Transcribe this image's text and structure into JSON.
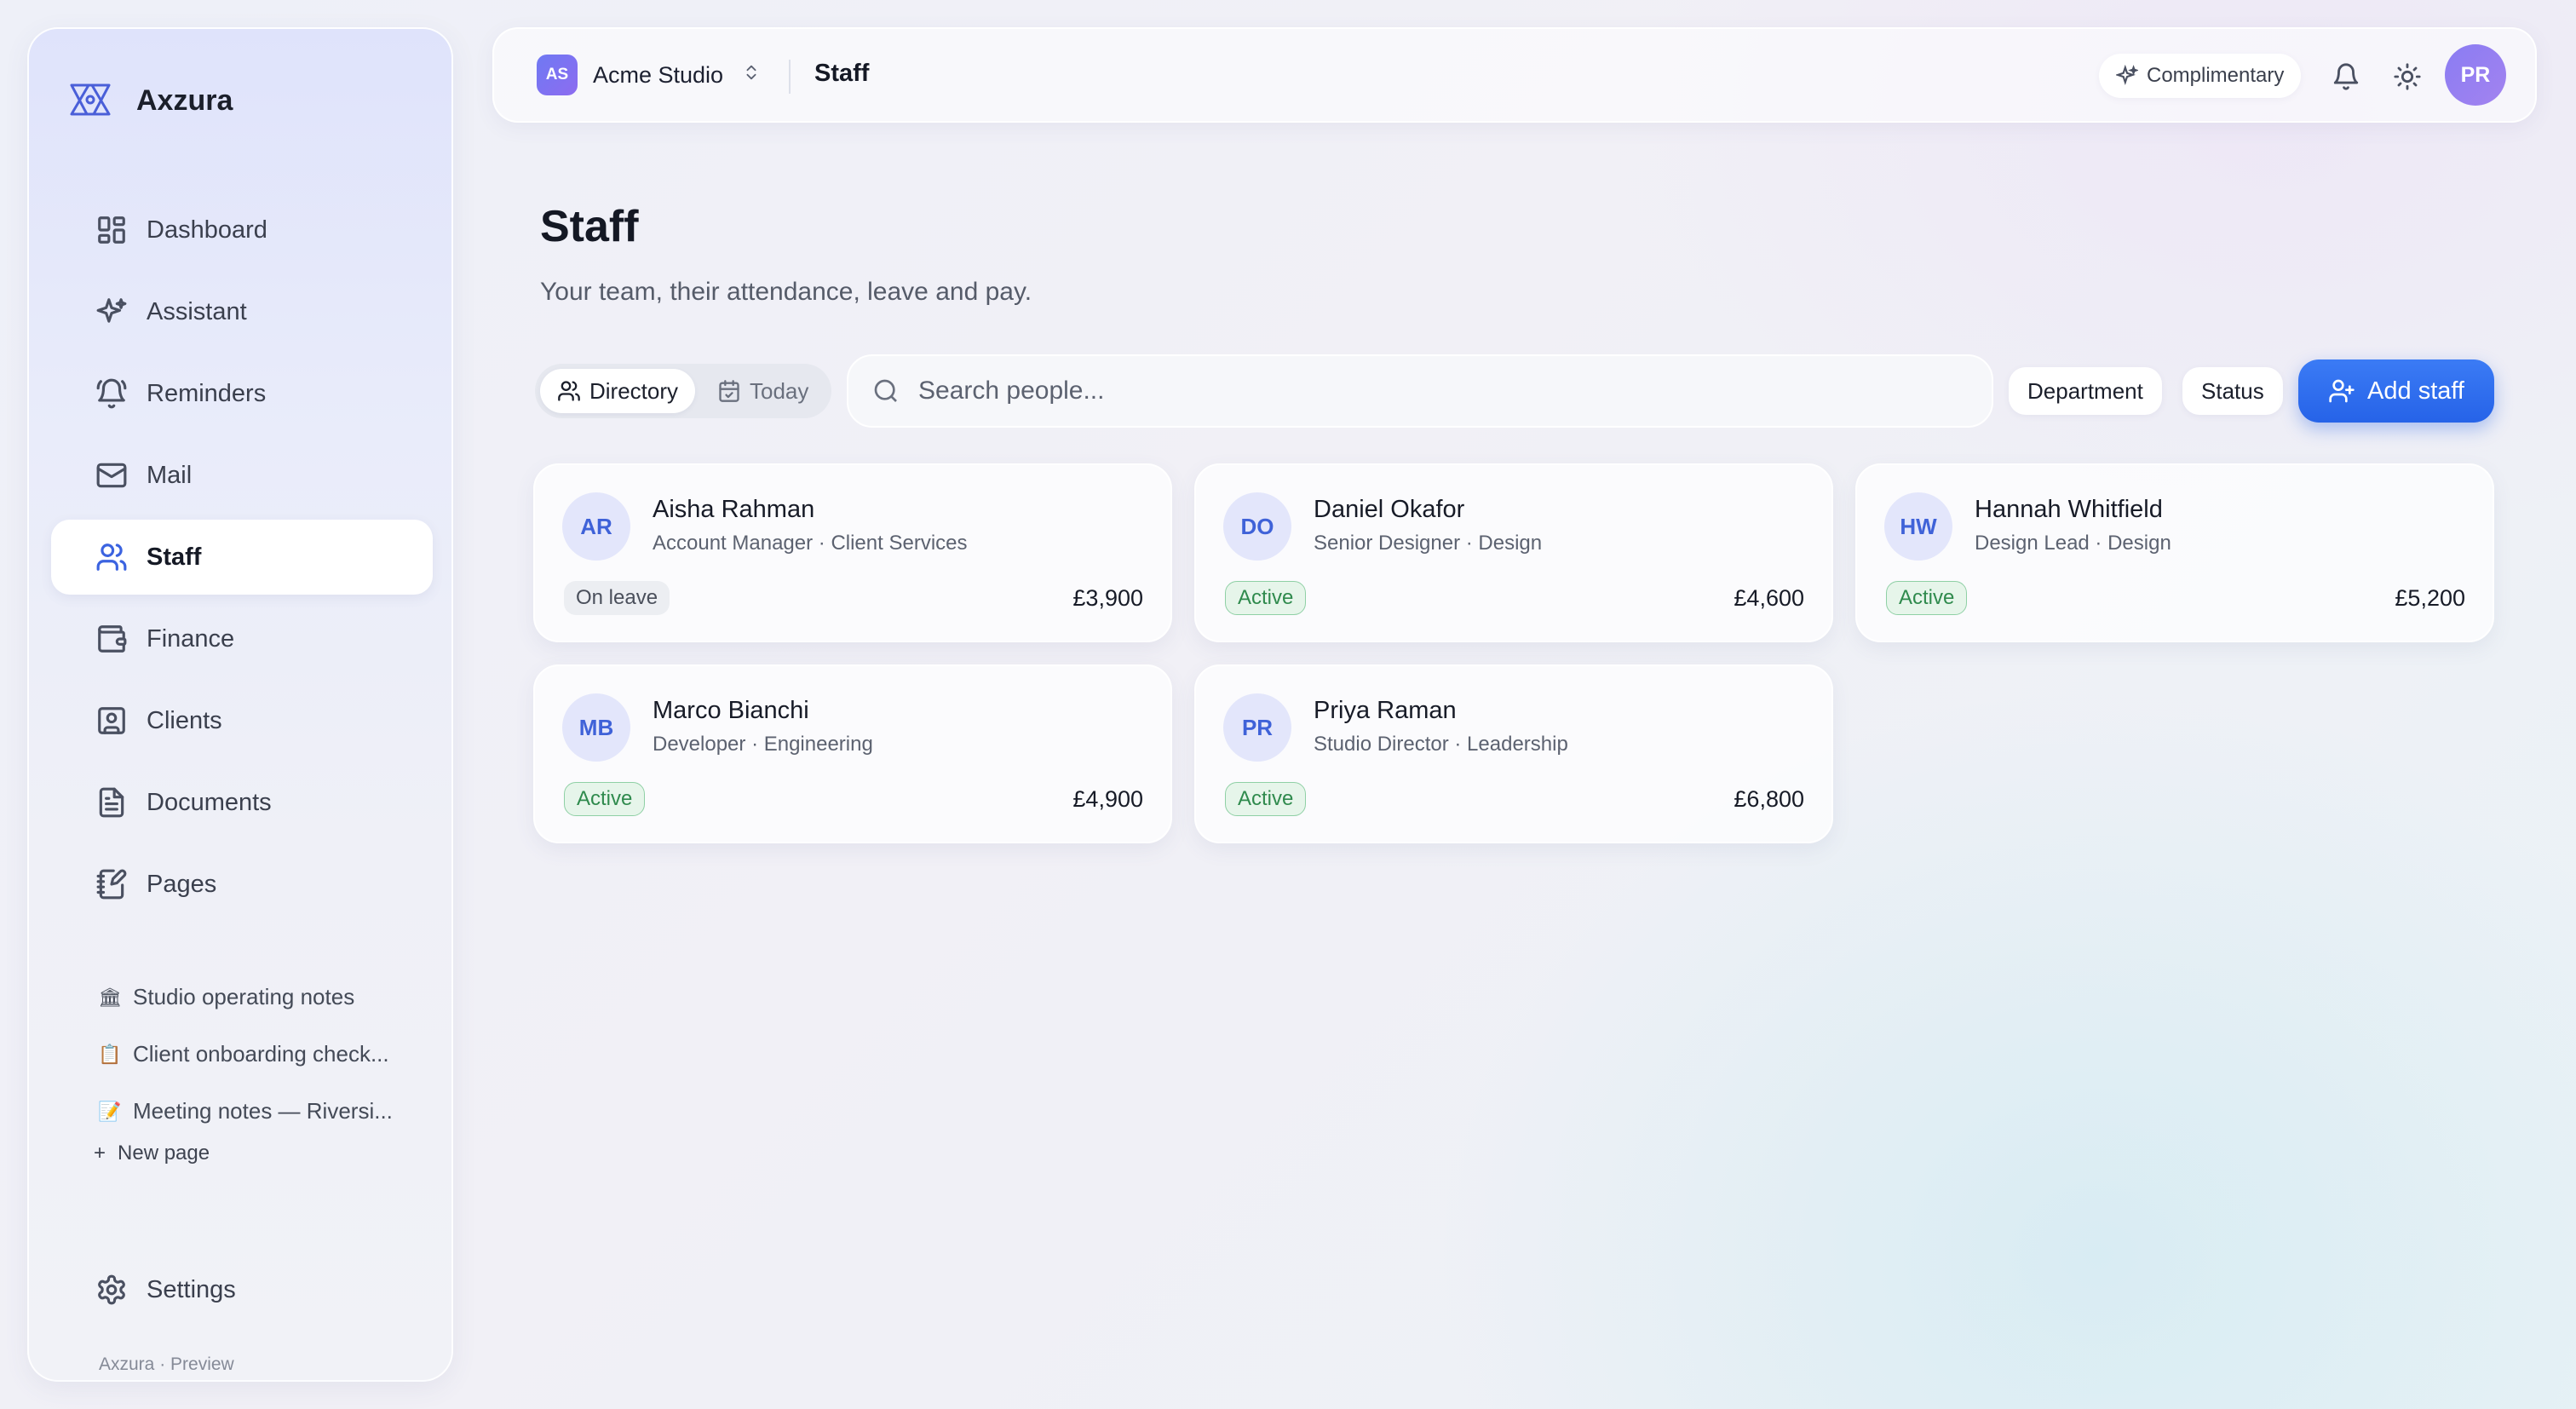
{
  "brand": {
    "name": "Axzura"
  },
  "nav": {
    "dashboard": "Dashboard",
    "assistant": "Assistant",
    "reminders": "Reminders",
    "mail": "Mail",
    "staff": "Staff",
    "finance": "Finance",
    "clients": "Clients",
    "documents": "Documents",
    "pages": "Pages"
  },
  "pages_list": [
    {
      "emoji": "🏛",
      "title": "Studio operating notes"
    },
    {
      "emoji": "📋",
      "title": "Client onboarding check..."
    },
    {
      "emoji": "📝",
      "title": "Meeting notes — Riversi..."
    }
  ],
  "new_page": "New page",
  "settings": "Settings",
  "footer": "Axzura · Preview",
  "topbar": {
    "workspace_initials": "AS",
    "workspace_name": "Acme Studio",
    "title": "Staff",
    "plan": "Complimentary",
    "user_initials": "PR"
  },
  "main": {
    "title": "Staff",
    "subtitle": "Your team, their attendance, leave and pay.",
    "tabs": {
      "directory": "Directory",
      "today": "Today"
    },
    "search_placeholder": "Search people...",
    "filters": {
      "department": "Department",
      "status": "Status"
    },
    "add_button": "Add staff"
  },
  "staff": [
    {
      "initials": "AR",
      "name": "Aisha Rahman",
      "role": "Account Manager · Client Services",
      "status": "On leave",
      "pay": "£3,900"
    },
    {
      "initials": "DO",
      "name": "Daniel Okafor",
      "role": "Senior Designer · Design",
      "status": "Active",
      "pay": "£4,600"
    },
    {
      "initials": "HW",
      "name": "Hannah Whitfield",
      "role": "Design Lead · Design",
      "status": "Active",
      "pay": "£5,200"
    },
    {
      "initials": "MB",
      "name": "Marco Bianchi",
      "role": "Developer · Engineering",
      "status": "Active",
      "pay": "£4,900"
    },
    {
      "initials": "PR",
      "name": "Priya Raman",
      "role": "Studio Director · Leadership",
      "status": "Active",
      "pay": "£6,800"
    }
  ],
  "colors": {
    "accent": "#2663e8",
    "active_badge": "#2f8a4d",
    "avatar_text": "#3f62d8"
  }
}
